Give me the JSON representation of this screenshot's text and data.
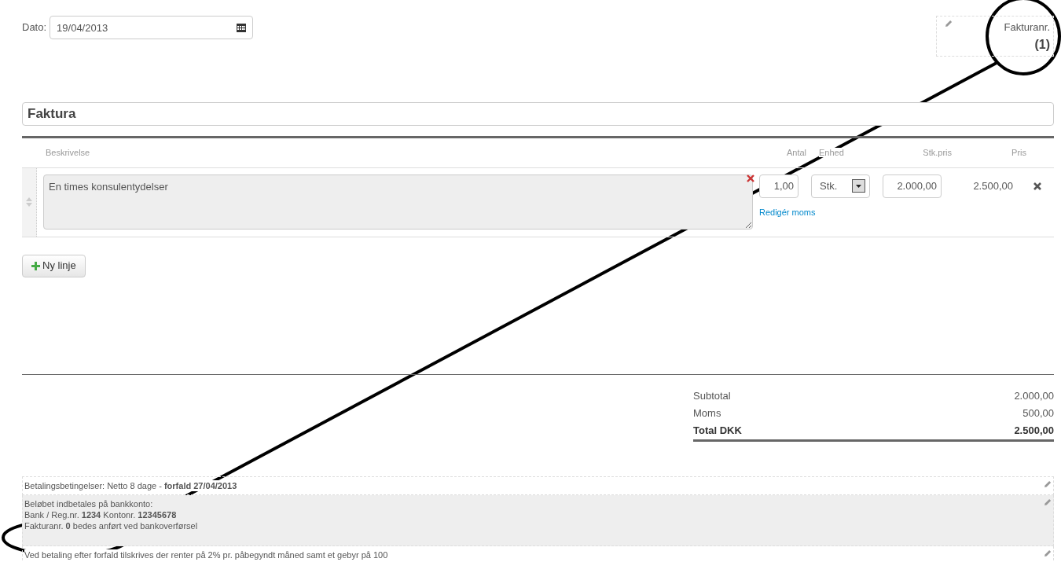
{
  "date": {
    "label": "Dato:",
    "value": "19/04/2013"
  },
  "invoice_number": {
    "label": "Fakturanr.",
    "value": "(1)"
  },
  "title": "Faktura",
  "columns": [
    "Beskrivelse",
    "Antal",
    "Enhed",
    "Stk.pris",
    "Pris"
  ],
  "lines": [
    {
      "description": "En times konsulentydelser",
      "quantity": "1,00",
      "unit": "Stk.",
      "unit_price": "2.000,00",
      "price": "2.500,00",
      "vat_link": "Redigér moms"
    }
  ],
  "add_line_button": "Ny linje",
  "totals": [
    {
      "label": "Subtotal",
      "value": "2.000,00",
      "bold": false
    },
    {
      "label": "Moms",
      "value": "500,00",
      "bold": false
    },
    {
      "label": "Total DKK",
      "value": "2.500,00",
      "bold": true
    }
  ],
  "footer": [
    {
      "highlighted": false,
      "lines": [
        "Betalingsbetingelser: Netto 8 dage - **forfald 27/04/2013**"
      ]
    },
    {
      "highlighted": true,
      "lines": [
        "Beløbet indbetales på bankkonto:",
        "Bank / Reg.nr. **1234** Kontonr. **12345678**",
        "Fakturanr. **0** bedes anført ved bankoverførsel"
      ]
    },
    {
      "highlighted": false,
      "lines": [
        "Ved betaling efter forfald tilskrives der renter på 2% pr. påbegyndt måned samt et gebyr på 100"
      ]
    }
  ]
}
